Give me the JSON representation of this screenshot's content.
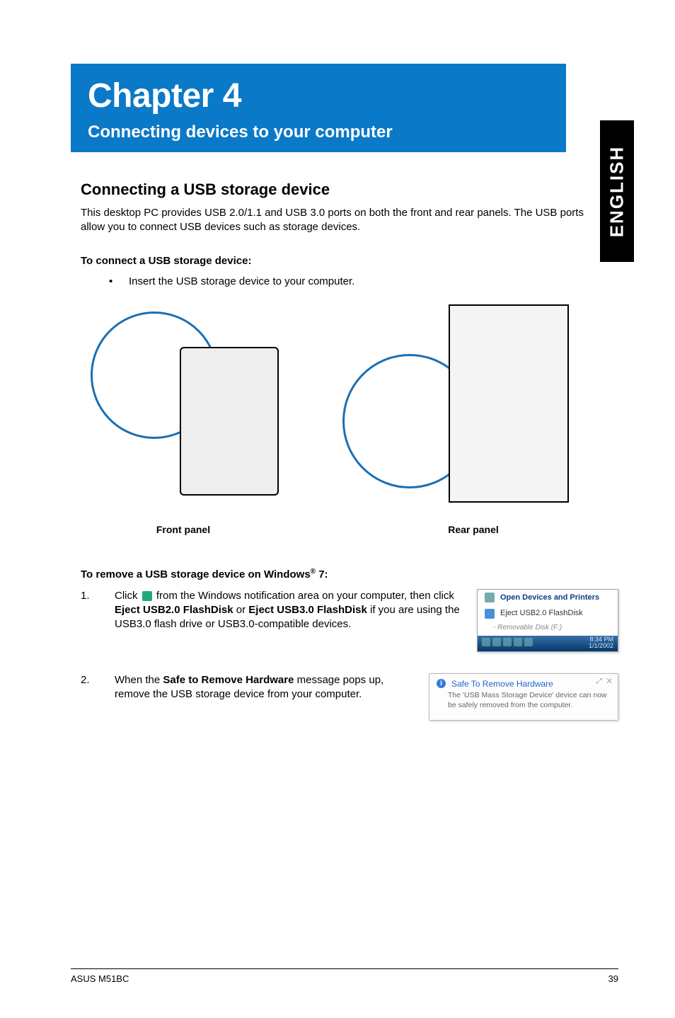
{
  "chapter": {
    "title": "Chapter 4",
    "subtitle": "Connecting devices to your computer"
  },
  "side_tab": "ENGLISH",
  "section": {
    "heading": "Connecting a USB storage device",
    "intro": "This desktop PC provides USB 2.0/1.1 and USB 3.0 ports on both the front and rear panels. The USB ports allow you to connect USB devices such as storage devices."
  },
  "connect": {
    "heading": "To connect a USB storage device:",
    "bullet_symbol": "•",
    "bullet_text": "Insert the USB storage device to your computer."
  },
  "panel_labels": {
    "front": "Front panel",
    "rear": "Rear panel"
  },
  "remove": {
    "heading_pre": "To remove a USB storage device on Windows",
    "heading_reg": "®",
    "heading_post": " 7:",
    "step1_num": "1.",
    "step1_a": "Click ",
    "step1_b": " from the Windows notification area on your computer, then click ",
    "step1_bold1": "Eject USB2.0 FlashDisk",
    "step1_c": " or ",
    "step1_bold2": "Eject USB3.0 FlashDisk",
    "step1_d": " if you are using the USB3.0 flash drive or USB3.0-compatible devices.",
    "step2_num": "2.",
    "step2_a": "When the ",
    "step2_bold": "Safe to Remove Hardware",
    "step2_b": " message pops up, remove the USB storage device from your computer."
  },
  "popup_eject": {
    "row1": "Open Devices and Printers",
    "row2": "Eject USB2.0 FlashDisk",
    "row3": "- Removable Disk (F:)",
    "clock_time": "8:34 PM",
    "clock_date": "1/1/2002"
  },
  "popup_safe": {
    "title": "Safe To Remove Hardware",
    "body": "The 'USB Mass Storage Device' device can now be safely removed from the computer.",
    "close_hint": "✕"
  },
  "footer": {
    "left": "ASUS M51BC",
    "right": "39"
  }
}
